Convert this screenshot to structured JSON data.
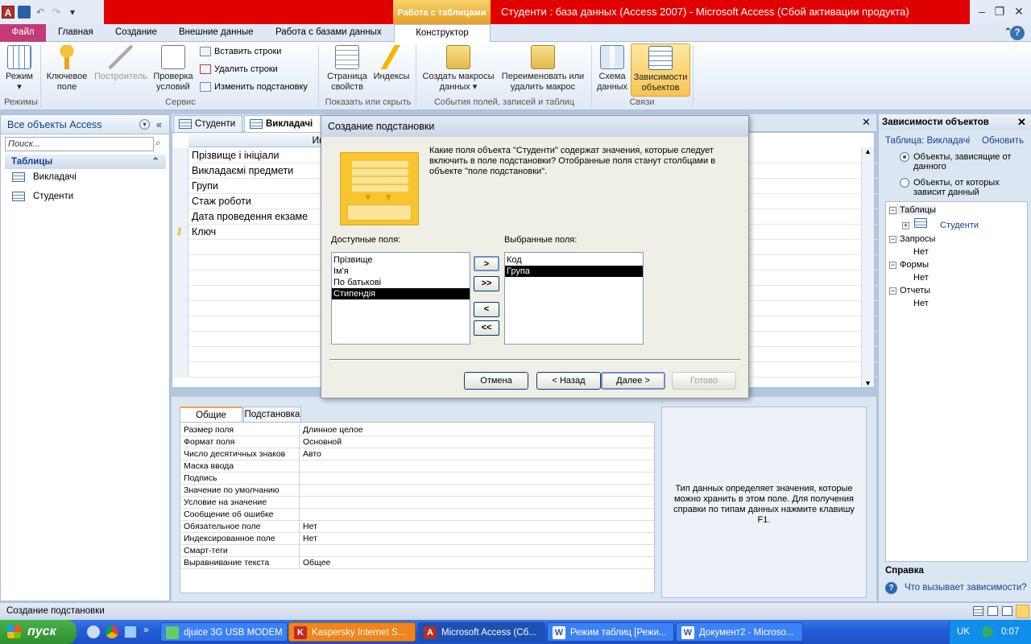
{
  "window": {
    "context_tab": "Работа с таблицами",
    "title": "Студенти : база данных (Access 2007)  -  Microsoft Access (Сбой активации продукта)"
  },
  "qat": {
    "app_icon": "A"
  },
  "tabs": [
    "Файл",
    "Главная",
    "Создание",
    "Внешние данные",
    "Работа с базами данных",
    "Конструктор"
  ],
  "ribbon": {
    "rezhim": "Режим",
    "key_field": "Ключевое поле",
    "builder": "Построитель",
    "check": "Проверка условий",
    "insert_rows": "Вставить строки",
    "delete_rows": "Удалить строки",
    "modify_lookup": "Изменить подстановку",
    "prop_sheet": "Страница свойств",
    "indexes": "Индексы",
    "create_macro": "Создать макросы данных",
    "rename_macro": "Переименовать или удалить макрос",
    "schema": "Схема данных",
    "dependencies": "Зависимости объектов",
    "groups": {
      "modes": "Режимы",
      "service": "Сервис",
      "show_hide": "Показать или скрыть",
      "events": "События полей, записей и таблиц",
      "relations": "Связи"
    }
  },
  "nav": {
    "header": "Все объекты Access",
    "search_placeholder": "Поиск...",
    "group": "Таблицы",
    "items": [
      "Викладачі",
      "Студенти"
    ]
  },
  "doctabs": [
    "Студенти",
    "Викладачі"
  ],
  "grid": {
    "header": "Имя поля",
    "rows": [
      "Прізвище і ініціали",
      "Викладаємі предмети",
      "Групи",
      "Стаж роботи",
      "Дата проведення екзаме",
      "Ключ"
    ]
  },
  "props": {
    "tab_general": "Общие",
    "tab_lookup": "Подстановка",
    "rows": [
      {
        "k": "Размер поля",
        "v": "Длинное целое"
      },
      {
        "k": "Формат поля",
        "v": "Основной"
      },
      {
        "k": "Число десятичных знаков",
        "v": "Авто"
      },
      {
        "k": "Маска ввода",
        "v": ""
      },
      {
        "k": "Подпись",
        "v": ""
      },
      {
        "k": "Значение по умолчанию",
        "v": ""
      },
      {
        "k": "Условие на значение",
        "v": ""
      },
      {
        "k": "Сообщение об ошибке",
        "v": ""
      },
      {
        "k": "Обязательное поле",
        "v": "Нет"
      },
      {
        "k": "Индексированное поле",
        "v": "Нет"
      },
      {
        "k": "Смарт-теги",
        "v": ""
      },
      {
        "k": "Выравнивание текста",
        "v": "Общее"
      }
    ],
    "help": "Тип данных определяет значения, которые можно хранить в этом поле. Для получения справки по типам данных нажмите клавишу F1."
  },
  "rpane": {
    "title": "Зависимости объектов",
    "table_label": "Таблица: Викладачі",
    "refresh": "Обновить",
    "radio1": "Объекты, зависящие от данного",
    "radio2": "Объекты, от которых зависит данный",
    "tree": {
      "tables": "Таблицы",
      "students": "Студенти",
      "queries": "Запросы",
      "forms": "Формы",
      "reports": "Отчеты",
      "none": "Нет"
    },
    "help_title": "Справка",
    "help_link": "Что вызывает зависимости?"
  },
  "dialog": {
    "title": "Создание подстановки",
    "prompt": "Какие поля объекта \"Студенти\" содержат значения, которые следует включить в поле подстановки? Отобранные поля станут столбцами в объекте \"поле подстановки\".",
    "available_label": "Доступные поля:",
    "selected_label": "Выбранные поля:",
    "available": [
      "Прізвище",
      "Ім'я",
      "По батькові",
      "Стипендія"
    ],
    "selected": [
      "Код",
      "Група"
    ],
    "move_one": ">",
    "move_all": ">>",
    "back_one": "<",
    "back_all": "<<",
    "cancel": "Отмена",
    "back": "< Назад",
    "next": "Далее >",
    "finish": "Готово"
  },
  "status": "Создание подстановки",
  "taskbar": {
    "start": "пуск",
    "tasks": [
      "djuice 3G USB MODEM",
      "Kaspersky Internet S...",
      "Microsoft Access (Сб...",
      "Режим таблиц [Режи...",
      "Документ2 - Microso..."
    ],
    "lang": "UK",
    "time": "0:07"
  }
}
